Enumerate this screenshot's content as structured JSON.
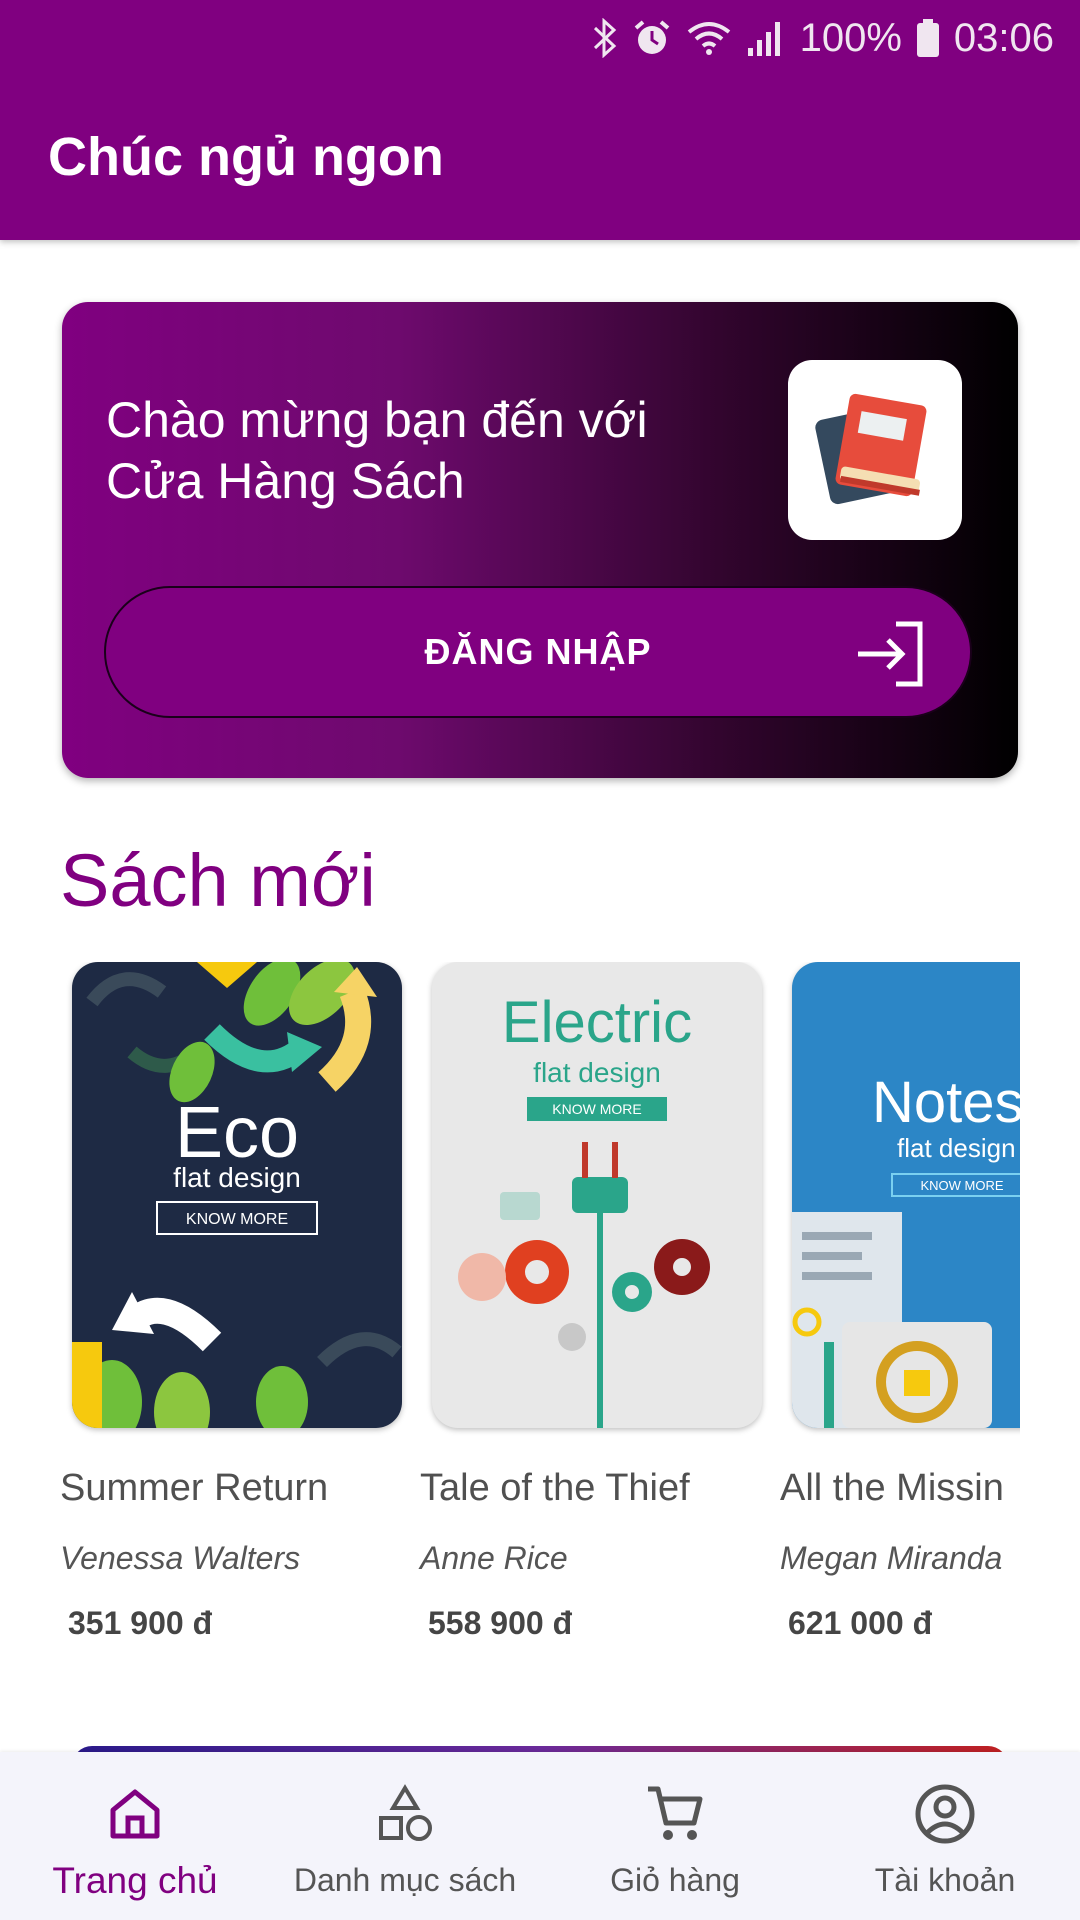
{
  "status_bar": {
    "battery": "100%",
    "time": "03:06",
    "icons": [
      "bluetooth-icon",
      "alarm-icon",
      "wifi-icon",
      "signal-icon",
      "battery-icon"
    ]
  },
  "app_bar": {
    "title": "Chúc ngủ ngon"
  },
  "welcome_card": {
    "line1": "Chào mừng bạn đến với",
    "line2": "Cửa Hàng Sách",
    "login_label": "ĐĂNG NHẬP",
    "logo_icon": "book-icon",
    "gradient": [
      "#800080",
      "#000000"
    ]
  },
  "new_books": {
    "title": "Sách mới",
    "items": [
      {
        "title": "Summer Return",
        "author": "Venessa Walters",
        "price": "351 900 đ",
        "cover": {
          "main": "Eco",
          "sub": "flat design",
          "cta": "KNOW MORE",
          "bg": "#1e2a44"
        }
      },
      {
        "title": "Tale of the Thief",
        "author": "Anne Rice",
        "price": "558 900 đ",
        "cover": {
          "main": "Electric",
          "sub": "flat design",
          "cta": "KNOW MORE",
          "bg": "#e8e8e8"
        }
      },
      {
        "title": "All the Missin",
        "author": "Megan Miranda",
        "price": "621 000 đ",
        "cover": {
          "main": "Notes",
          "sub": "flat design",
          "cta": "KNOW MORE",
          "bg": "#2c86c6"
        }
      }
    ]
  },
  "bottom_nav": {
    "items": [
      {
        "label": "Trang chủ",
        "icon": "home-icon",
        "active": true
      },
      {
        "label": "Danh mục sách",
        "icon": "category-icon",
        "active": false
      },
      {
        "label": "Giỏ hàng",
        "icon": "cart-icon",
        "active": false
      },
      {
        "label": "Tài khoản",
        "icon": "account-icon",
        "active": false
      }
    ]
  },
  "colors": {
    "primary": "#800080",
    "nav_bg": "#f4f4fb"
  }
}
